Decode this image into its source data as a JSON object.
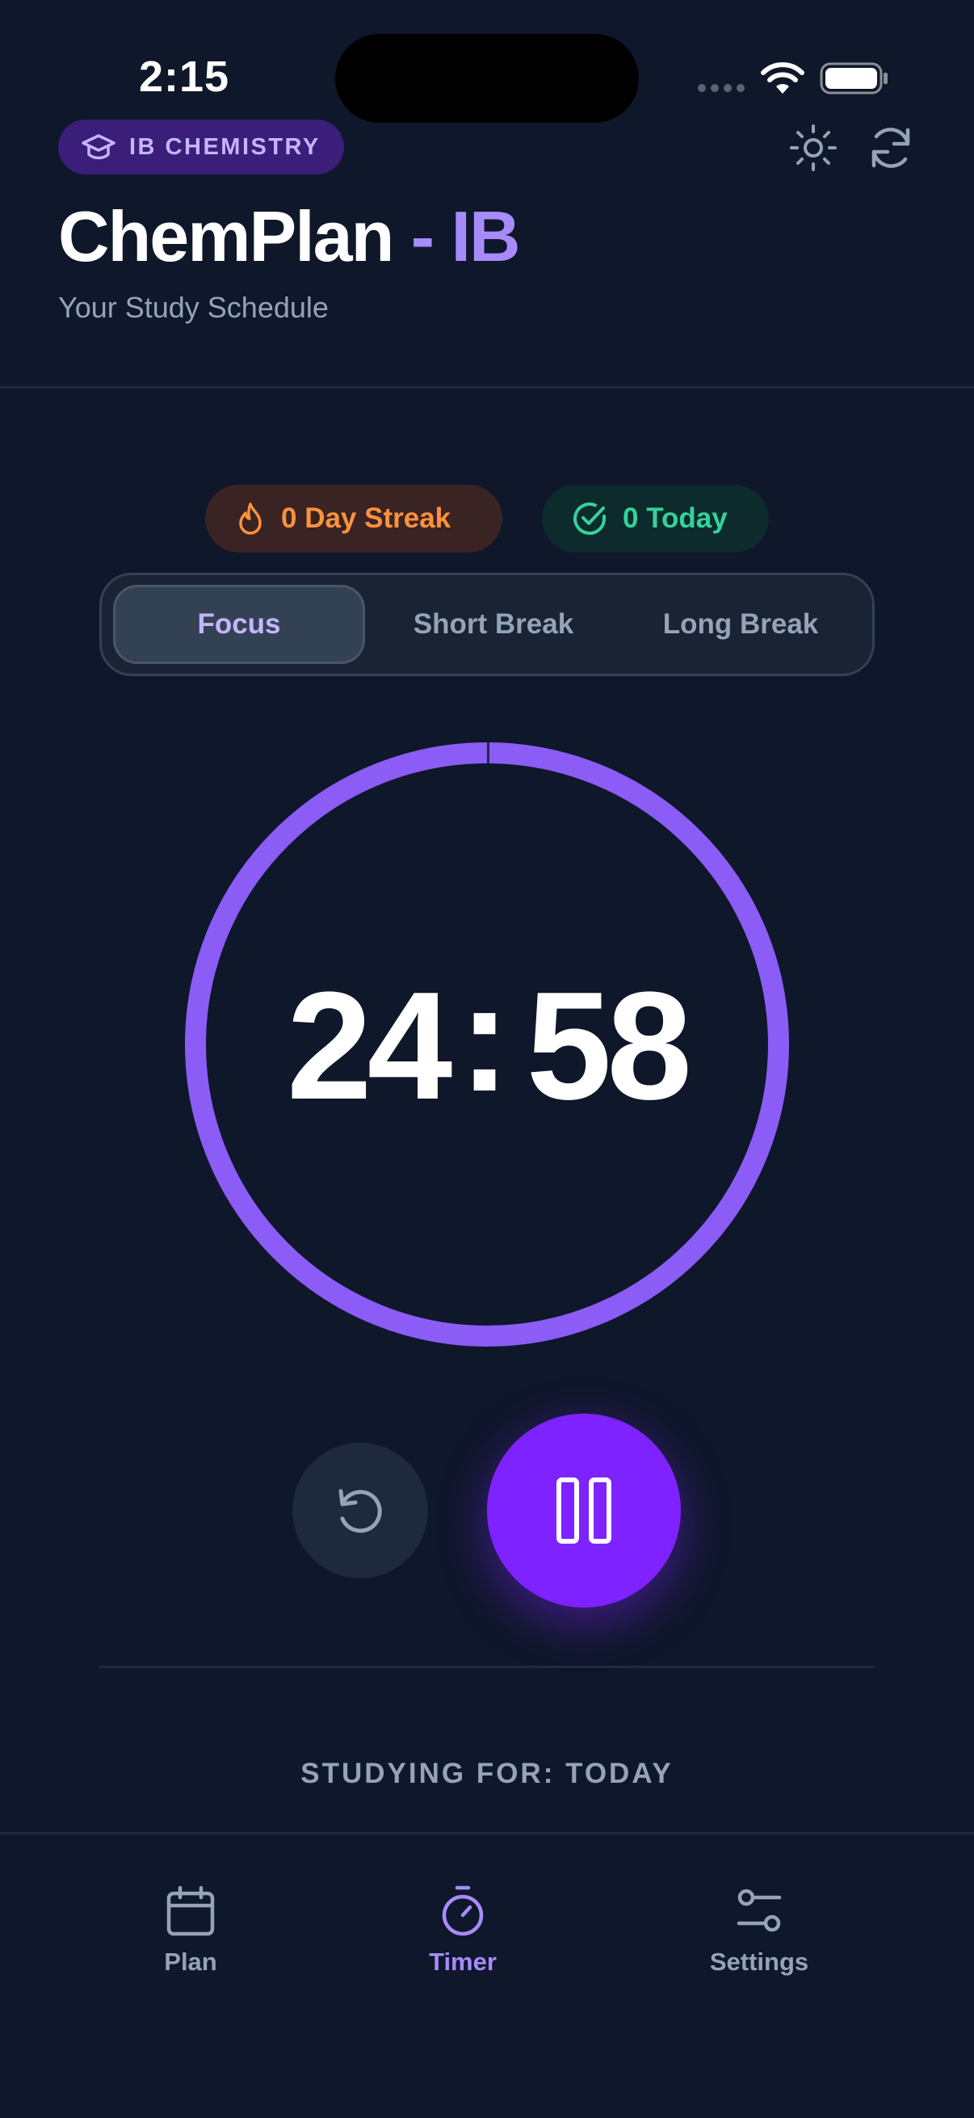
{
  "status_bar": {
    "time": "2:15"
  },
  "header": {
    "badge": "IB CHEMISTRY",
    "title_main": "ChemPlan",
    "title_accent": "- IB",
    "subtitle": "Your Study Schedule"
  },
  "stats": {
    "streak": "0 Day Streak",
    "today": "0 Today"
  },
  "modes": {
    "items": [
      "Focus",
      "Short Break",
      "Long Break"
    ],
    "selected": "Focus"
  },
  "timer": {
    "display": "24:58",
    "minutes": "24",
    "separator": ":",
    "seconds": "58",
    "remaining_fraction": 0.9987
  },
  "studying": "STUDYING FOR: TODAY",
  "nav": {
    "items": [
      {
        "label": "Plan",
        "icon": "calendar-icon"
      },
      {
        "label": "Timer",
        "icon": "stopwatch-icon"
      },
      {
        "label": "Settings",
        "icon": "sliders-icon"
      }
    ],
    "active": "Timer"
  },
  "colors": {
    "background": "#0f172a",
    "accent": "#a78bfa",
    "primary_button": "#7e22ff",
    "streak": "#fb923c",
    "today": "#34d399"
  }
}
